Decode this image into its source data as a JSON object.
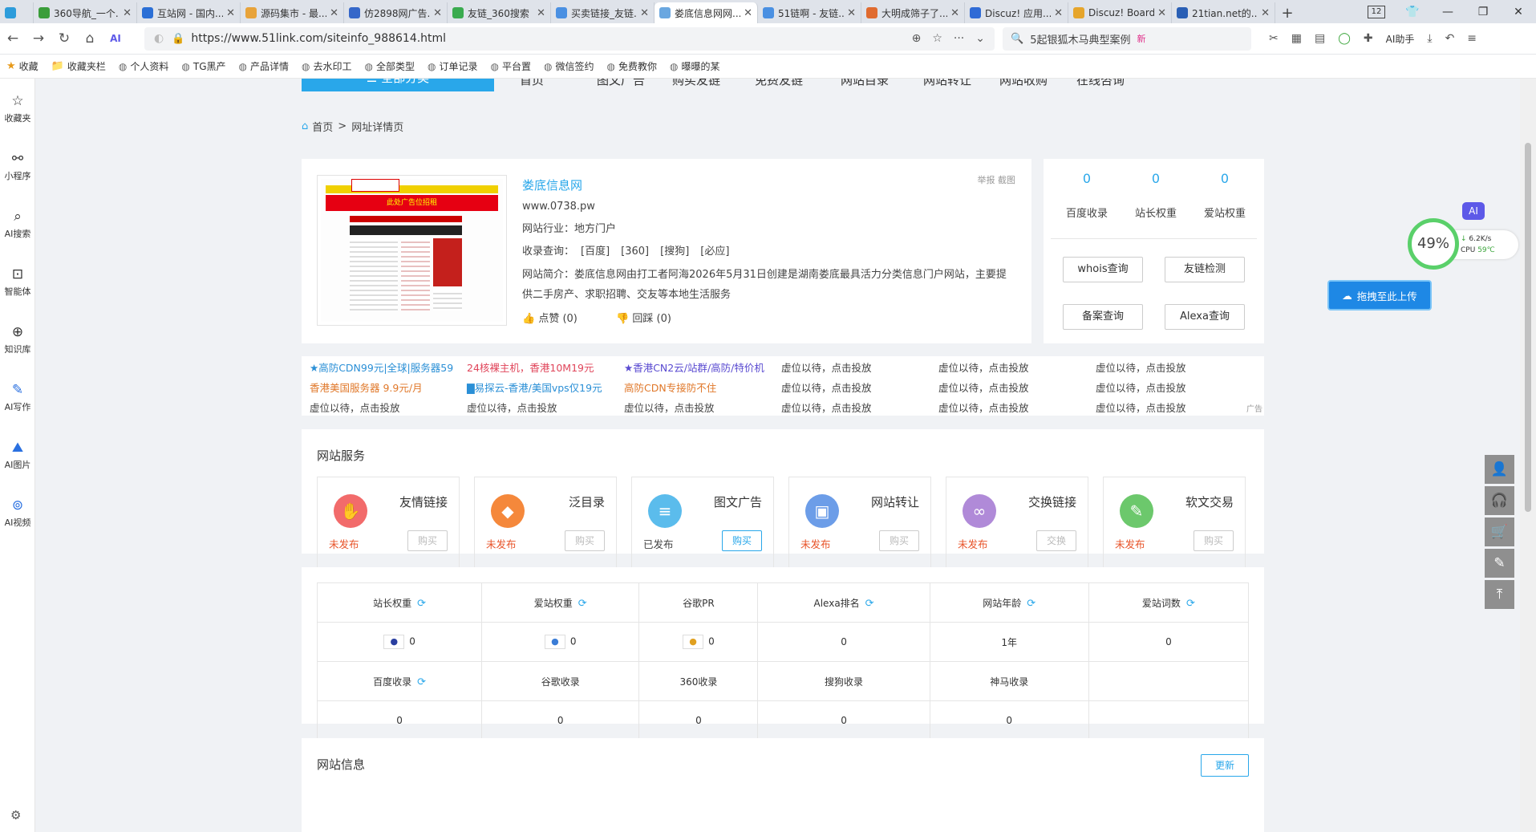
{
  "browser": {
    "tabs": [
      {
        "title": "",
        "color": "#2d9cdb"
      },
      {
        "title": "360导航_一个...",
        "color": "#3a9d3a"
      },
      {
        "title": "互站网 - 国内...",
        "color": "#2b6fd6"
      },
      {
        "title": "源码集市 - 最...",
        "color": "#e8a33a"
      },
      {
        "title": "仿2898网广告...",
        "color": "#3567c9"
      },
      {
        "title": "友链_360搜索",
        "color": "#3aab4f"
      },
      {
        "title": "买卖链接_友链...",
        "color": "#4a90e2"
      },
      {
        "title": "娄底信息网网...",
        "color": "#6aa7e0",
        "active": true
      },
      {
        "title": "51链啊 - 友链...",
        "color": "#4a90e2"
      },
      {
        "title": "大明成筛子了...",
        "color": "#e06b2f"
      },
      {
        "title": "Discuz! 应用...",
        "color": "#2f6bd6"
      },
      {
        "title": "Discuz! Board",
        "color": "#e6a52b"
      },
      {
        "title": "21tian.net的...",
        "color": "#2a5fb5"
      }
    ],
    "tab_count": "12",
    "url": "https://www.51link.com/siteinfo_988614.html",
    "search_text": "5起银狐木马典型案例",
    "search_badge": "新",
    "ai_assistant": "AI助手",
    "bookmarks": [
      "收藏",
      "收藏夹栏",
      "个人资料",
      "TG黑产",
      "产品详情",
      "去水印工",
      "全部类型",
      "订单记录",
      "平台置",
      "微信签约",
      "免费教你",
      "曝曝的某"
    ]
  },
  "left_sidebar": [
    "收藏夹",
    "小程序",
    "AI搜索",
    "智能体",
    "知识库",
    "AI写作",
    "AI图片",
    "AI视频"
  ],
  "nav": {
    "category": "全部分类",
    "links": [
      "首页",
      "图文广告",
      "购买友链",
      "免费友链",
      "网站目录",
      "网站转让",
      "网站收购",
      "在线咨询"
    ]
  },
  "breadcrumb": {
    "home": "首页",
    "sep": ">",
    "current": "网址详情页"
  },
  "site": {
    "name": "娄底信息网",
    "domain": "www.0738.pw",
    "industry_label": "网站行业：",
    "industry": "地方门户",
    "indexed_label": "收录查询：",
    "indexed_engines": [
      "[百度]",
      "[360]",
      "[搜狗]",
      "[必应]"
    ],
    "intro_label": "网站简介：",
    "intro": "娄底信息网由打工者阿海2026年5月31日创建是湖南娄底最具活力分类信息门户网站，主要提供二手房产、求职招聘、交友等本地生活服务",
    "like": "点赞 (0)",
    "dislike": "回踩 (0)",
    "report": "举报 截图",
    "thumb_banner": "此处广告位招租"
  },
  "weights": {
    "values": [
      {
        "n": "0",
        "label": "百度收录"
      },
      {
        "n": "0",
        "label": "站长权重"
      },
      {
        "n": "0",
        "label": "爱站权重"
      }
    ],
    "buttons": [
      "whois查询",
      "友链检测",
      "备案查询",
      "Alexa查询"
    ]
  },
  "ads": {
    "rows": [
      [
        {
          "t": "★高防CDN99元|全球|服务器59",
          "c": "#2a8fd6"
        },
        {
          "t": "24核裸主机，香港10M19元",
          "c": "#e0455a"
        },
        {
          "t": "★香港CN2云/站群/高防/特价机",
          "c": "#5a4bd1"
        },
        {
          "t": "虚位以待，点击投放",
          "c": "#444"
        },
        {
          "t": "虚位以待，点击投放",
          "c": "#444"
        },
        {
          "t": "虚位以待，点击投放",
          "c": "#444"
        }
      ],
      [
        {
          "t": "香港美国服务器 9.9元/月",
          "c": "#e0782a"
        },
        {
          "t": "▇易探云-香港/美国vps仅19元",
          "c": "#2a8fd6"
        },
        {
          "t": "高防CDN专接防不住",
          "c": "#e0782a"
        },
        {
          "t": "虚位以待，点击投放",
          "c": "#444"
        },
        {
          "t": "虚位以待，点击投放",
          "c": "#444"
        },
        {
          "t": "虚位以待，点击投放",
          "c": "#444"
        }
      ],
      [
        {
          "t": "虚位以待，点击投放",
          "c": "#444"
        },
        {
          "t": "虚位以待，点击投放",
          "c": "#444"
        },
        {
          "t": "虚位以待，点击投放",
          "c": "#444"
        },
        {
          "t": "虚位以待，点击投放",
          "c": "#444"
        },
        {
          "t": "虚位以待，点击投放",
          "c": "#444"
        },
        {
          "t": "虚位以待，点击投放",
          "c": "#444"
        }
      ]
    ],
    "tag": "广告"
  },
  "services": {
    "title": "网站服务",
    "items": [
      {
        "name": "友情链接",
        "status": "未发布",
        "status_color": "#e8542a",
        "button": "购买",
        "active": false,
        "icon": "handshake-icon",
        "color": "#f26b6b",
        "glyph": "✋"
      },
      {
        "name": "泛目录",
        "status": "未发布",
        "status_color": "#e8542a",
        "button": "购买",
        "active": false,
        "icon": "tag-icon",
        "color": "#f5883b",
        "glyph": "◆"
      },
      {
        "name": "图文广告",
        "status": "已发布",
        "status_color": "#444",
        "button": "购买",
        "active": true,
        "icon": "document-icon",
        "color": "#5bbcec",
        "glyph": "≡"
      },
      {
        "name": "网站转让",
        "status": "未发布",
        "status_color": "#e8542a",
        "button": "购买",
        "active": false,
        "icon": "image-icon",
        "color": "#6c9de8",
        "glyph": "▣"
      },
      {
        "name": "交换链接",
        "status": "未发布",
        "status_color": "#e8542a",
        "button": "交换",
        "active": false,
        "icon": "link-icon",
        "color": "#b08ad8",
        "glyph": "∞"
      },
      {
        "name": "软文交易",
        "status": "未发布",
        "status_color": "#e8542a",
        "button": "购买",
        "active": false,
        "icon": "edit-icon",
        "color": "#6cc86c",
        "glyph": "✎"
      }
    ]
  },
  "stats": {
    "row1_labels": [
      "站长权重",
      "爱站权重",
      "谷歌PR",
      "Alexa排名",
      "网站年龄",
      "爱站词数"
    ],
    "row1_values": [
      "0",
      "0",
      "0",
      "0",
      "1年",
      "0"
    ],
    "row2_labels": [
      "百度收录",
      "谷歌收录",
      "360收录",
      "搜狗收录",
      "神马收录",
      ""
    ],
    "row2_values": [
      "0",
      "0",
      "0",
      "0",
      "0",
      ""
    ]
  },
  "siteinfo2": {
    "title": "网站信息",
    "update": "更新"
  },
  "floats": {
    "cpu_percent": "49%",
    "net_speed": "6.2K/s",
    "cpu_label": "CPU",
    "cpu_temp": "59℃",
    "ai_badge": "AI",
    "upload": "拖拽至此上传"
  }
}
